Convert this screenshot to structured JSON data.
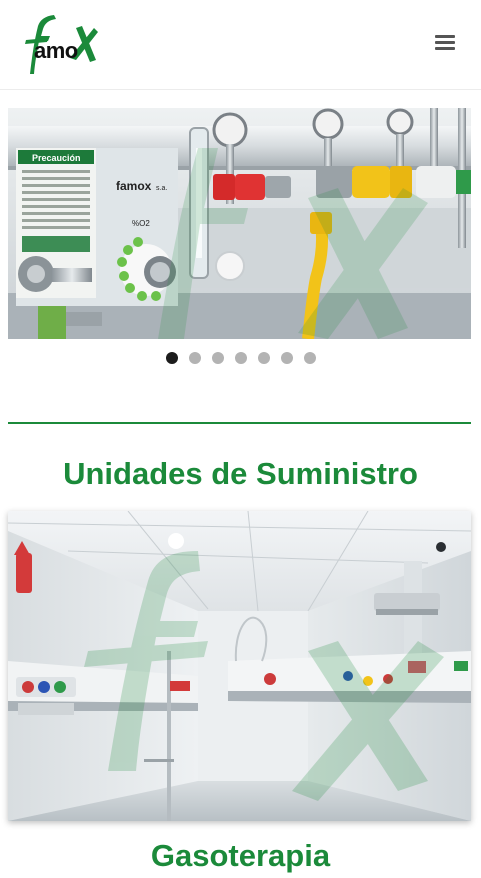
{
  "brand": {
    "logo_text": "amo",
    "logo_icon": "famox-logo-icon",
    "green": "#1b8a3a",
    "dark_green": "#0f6b2a"
  },
  "header": {
    "menu_icon": "hamburger-menu-icon"
  },
  "hero_slider": {
    "image_description_icon": "medical-gas-panel-image",
    "panel_title": "Precaución",
    "panel_brand": "famox",
    "panel_brand_suffix": "s.a.",
    "panel_gauge_label": "%O2",
    "slide_count": 7,
    "active_slide": 1
  },
  "sections": [
    {
      "title": "Unidades de Suministro",
      "image_icon": "hospital-room-supply-unit-image"
    },
    {
      "title": "Gasoterapia"
    }
  ],
  "colors": {
    "title_green": "#1b8a3a",
    "divider_green": "#1b8a3a",
    "dot_active": "#1c1c1c",
    "dot_inactive": "#b3b3b3"
  }
}
